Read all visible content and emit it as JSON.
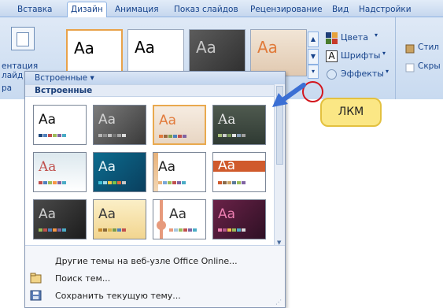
{
  "tabs": [
    {
      "label": "Вставка",
      "active": false
    },
    {
      "label": "Дизайн",
      "active": true
    },
    {
      "label": "Анимация",
      "active": false
    },
    {
      "label": "Показ слайдов",
      "active": false
    },
    {
      "label": "Рецензирование",
      "active": false
    },
    {
      "label": "Вид",
      "active": false
    },
    {
      "label": "Надстройки",
      "active": false
    }
  ],
  "ribbon": {
    "left_labels": [
      "ентация",
      "лайд",
      "ра"
    ],
    "gallery_thumbs": [
      "Aa",
      "Aa",
      "Aa",
      "Aa"
    ],
    "theme_options": [
      {
        "label": "Цвета",
        "icon": "color-palette-icon"
      },
      {
        "label": "Шрифты",
        "icon": "font-icon"
      },
      {
        "label": "Эффекты",
        "icon": "effects-icon"
      }
    ],
    "right_group": [
      {
        "label": "Стил",
        "icon": "styles-icon"
      },
      {
        "label": "Скры",
        "icon": "hide-icon"
      }
    ]
  },
  "panel": {
    "header": "Встроенные ▾",
    "section": "Встроенные",
    "thumb_text": "Aa",
    "footer": [
      {
        "label": "Другие темы на веб-узле Office Online...",
        "icon": ""
      },
      {
        "label": "Поиск тем...",
        "icon": "folder-icon"
      },
      {
        "label": "Сохранить текущую тему...",
        "icon": "save-icon"
      }
    ]
  },
  "callout": {
    "label": "ЛКМ"
  },
  "colors": {
    "accent_red": "#d3161d",
    "arrow_blue": "#3b6fd4",
    "callout_bg": "#fbe785"
  }
}
